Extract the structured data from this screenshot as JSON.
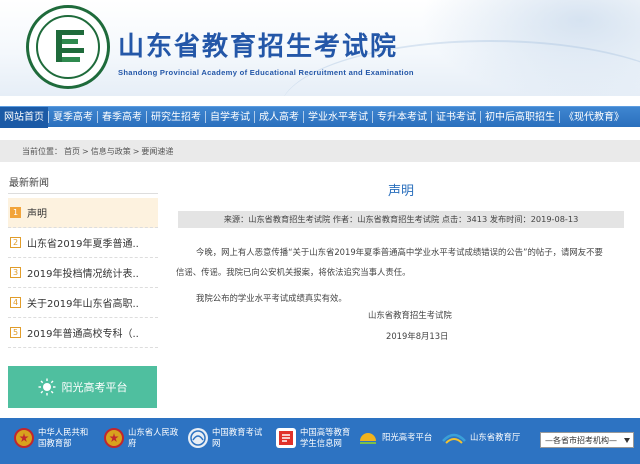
{
  "header": {
    "title": "山东省教育招生考试院",
    "subtitle": "Shandong Provincial Academy of Educational Recruitment and Examination",
    "logo_ring_text": "Shandong Provincial Academy of Educational Admission & Examination"
  },
  "nav": {
    "items": [
      "网站首页",
      "夏季高考",
      "春季高考",
      "研究生招考",
      "自学考试",
      "成人高考",
      "学业水平考试",
      "专升本考试",
      "证书考试",
      "初中后高职招生",
      "《现代教育》"
    ]
  },
  "breadcrumb": {
    "prefix": "当前位置：",
    "items": [
      "首页",
      "信息与政策",
      "要闻速递"
    ],
    "sep": ">"
  },
  "sidebar": {
    "title": "最新新闻",
    "items": [
      {
        "num": "1",
        "label": "声明"
      },
      {
        "num": "2",
        "label": "山东省2019年夏季普通.."
      },
      {
        "num": "3",
        "label": "2019年投档情况统计表.."
      },
      {
        "num": "4",
        "label": "关于2019年山东省高职.."
      },
      {
        "num": "5",
        "label": "2019年普通高校专科（.."
      }
    ],
    "banner_label": "阳光高考平台"
  },
  "article": {
    "title": "声明",
    "meta": "来源：山东省教育招生考试院 作者：山东省教育招生考试院 点击：3413 发布时间：2019-08-13",
    "para1a": "今晚，网上有人恶意传播“关于山东省2019年夏季普通高中学业水平考试成绩错误的公告”的帖子，请网友不要",
    "para1b": "信谣、传谣。我院已向公安机关报案，将依法追究当事人责任。",
    "para2": "我院公布的学业水平考试成绩真实有效。",
    "signature": "山东省教育招生考试院",
    "date": "2019年8月13日"
  },
  "footer": {
    "links": [
      {
        "line1": "中华人民共和",
        "line2": "国教育部",
        "icon": "national-emblem-icon",
        "color": "#d8a21e"
      },
      {
        "line1": "山东省人民政",
        "line2": "府",
        "icon": "national-emblem-icon",
        "color": "#d8a21e"
      },
      {
        "line1": "中国教育考试",
        "line2": "网",
        "icon": "neea-logo-icon",
        "color": "#e8eef5"
      },
      {
        "line1": "中国高等教育",
        "line2": "学生信息网",
        "icon": "chsi-logo-icon",
        "color": "#e0322b"
      },
      {
        "line1": "阳光高考平台",
        "line2": "",
        "icon": "sun-icon",
        "color": "#f0b31e"
      },
      {
        "line1": "山东省教育厅",
        "line2": "",
        "icon": "education-dept-logo-icon",
        "color": "#3aa0d8"
      }
    ],
    "select_value": "—各省市招考机构—"
  },
  "colors": {
    "nav_blue": "#2a6fbd",
    "title_blue": "#2457a8",
    "sidebar_accent": "#f2a43a",
    "banner_green": "#4fbf9f"
  }
}
